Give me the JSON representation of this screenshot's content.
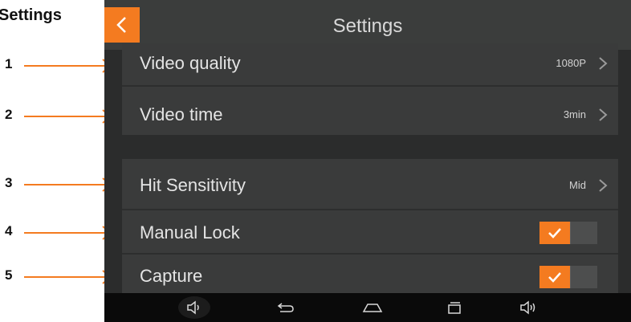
{
  "caption": "Settings",
  "callouts": [
    "1",
    "2",
    "3",
    "4",
    "5"
  ],
  "colors": {
    "accent": "#f47b20",
    "titlebar": "#3b3d3c",
    "panel": "#3a3b3b"
  },
  "titlebar": {
    "title": "Settings",
    "back_icon": "chevron-left-icon"
  },
  "settings": {
    "group1": [
      {
        "label": "Video quality",
        "value": "1080P"
      },
      {
        "label": "Video time",
        "value": "3min"
      }
    ],
    "group2": [
      {
        "label": "Hit Sensitivity",
        "value": "Mid"
      },
      {
        "label": "Manual Lock",
        "toggle": true
      },
      {
        "label": "Capture",
        "toggle": true
      }
    ]
  },
  "navbar": {
    "icons": [
      "volume-down-icon",
      "back-icon",
      "home-icon",
      "recent-apps-icon",
      "volume-up-icon"
    ]
  }
}
